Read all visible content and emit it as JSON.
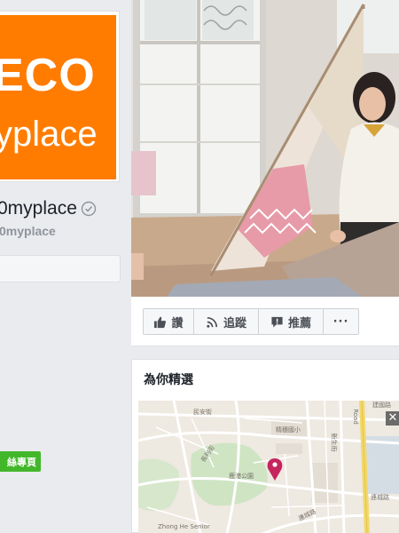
{
  "page": {
    "logo_line1": "ECO",
    "logo_line2": "yplace",
    "name": "0myplace",
    "handle": "0myplace",
    "green_button_label": "絲專頁"
  },
  "actions": {
    "like": "讚",
    "follow": "追蹤",
    "share": "推薦",
    "more": "···"
  },
  "featured": {
    "title": "為你精選",
    "close": "✕",
    "map_labels": {
      "road_east": "Road",
      "park": "鹿港公園",
      "school": "精穗國小",
      "street_top": "民安街",
      "street_left": "長利街",
      "street_right": "新生街",
      "street_bottom": "連城路",
      "street_bottom_right": "連城路",
      "place_bottom": "Zhong He Senior",
      "building_top_right": "建國路"
    }
  },
  "colors": {
    "brand_orange": "#ff7c00",
    "verified_gray": "#90949c",
    "green": "#42b72a",
    "map_pin": "#c6245e"
  }
}
